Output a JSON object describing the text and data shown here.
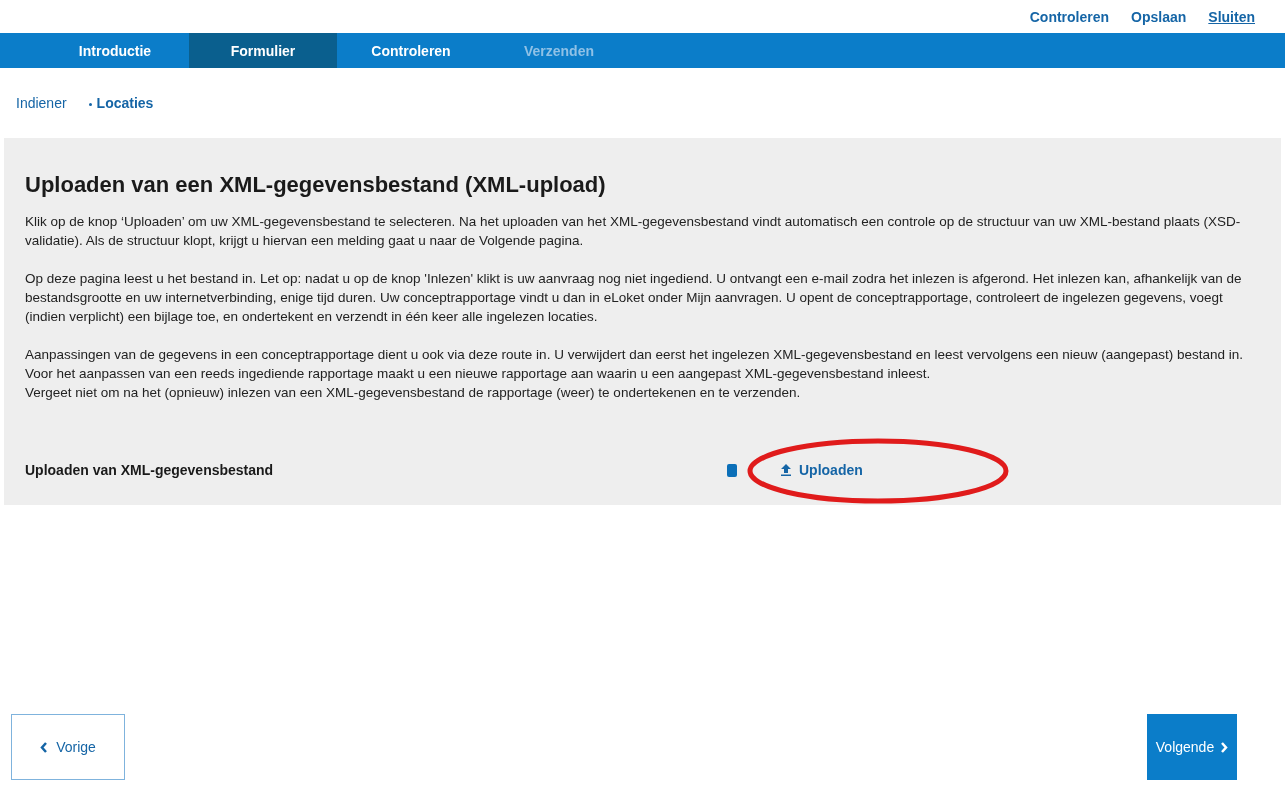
{
  "top_links": [
    {
      "label": "Controleren",
      "underlined": false
    },
    {
      "label": "Opslaan",
      "underlined": false
    },
    {
      "label": "Sluiten",
      "underlined": true
    }
  ],
  "tabs": [
    {
      "label": "Introductie",
      "selected": false,
      "disabled": false
    },
    {
      "label": "Formulier",
      "selected": true,
      "disabled": false
    },
    {
      "label": "Controleren",
      "selected": false,
      "disabled": false
    },
    {
      "label": "Verzenden",
      "selected": false,
      "disabled": true
    }
  ],
  "subnav": [
    {
      "label": "Indiener",
      "selected": false
    },
    {
      "label": "Locaties",
      "selected": true
    }
  ],
  "section": {
    "title": "Uploaden van een XML-gegevensbestand (XML-upload)",
    "paragraphs": [
      [
        "Klik op de knop ‘Uploaden’ om uw XML-gegevensbestand te selecteren. Na het uploaden van het XML-gegevensbestand vindt automatisch een controle op de structuur van uw XML-bestand plaats (XSD-validatie). Als de structuur klopt, krijgt u hiervan een melding gaat u naar de Volgende pagina."
      ],
      [
        "Op deze pagina leest u het bestand in. Let op: nadat u op de knop 'Inlezen' klikt is uw aanvraag nog niet ingediend. U ontvangt een e-mail zodra het inlezen is afgerond. Het inlezen kan, afhankelijk van de bestandsgrootte en uw internetverbinding, enige tijd duren. Uw conceptrapportage vindt u dan in eLoket onder Mijn aanvragen. U opent de conceptrapportage, controleert de ingelezen gegevens, voegt (indien verplicht) een bijlage toe, en ondertekent en verzendt in één keer alle ingelezen locaties."
      ],
      [
        "Aanpassingen van de gegevens in een conceptrapportage dient u ook via deze route in. U verwijdert dan eerst het ingelezen XML-gegevensbestand en leest vervolgens een nieuw (aangepast) bestand in.",
        "Voor het aanpassen van een reeds ingediende rapportage maakt u een nieuwe rapportage aan waarin u een aangepast XML-gegevensbestand inleest.",
        "Vergeet niet om na het (opnieuw) inlezen van een XML-gegevensbestand de rapportage (weer) te ondertekenen en te verzenden."
      ]
    ],
    "upload_label": "Uploaden van XML-gegevensbestand",
    "upload_button": "Uploaden"
  },
  "footer": {
    "previous": "Vorige",
    "next": "Volgende"
  }
}
